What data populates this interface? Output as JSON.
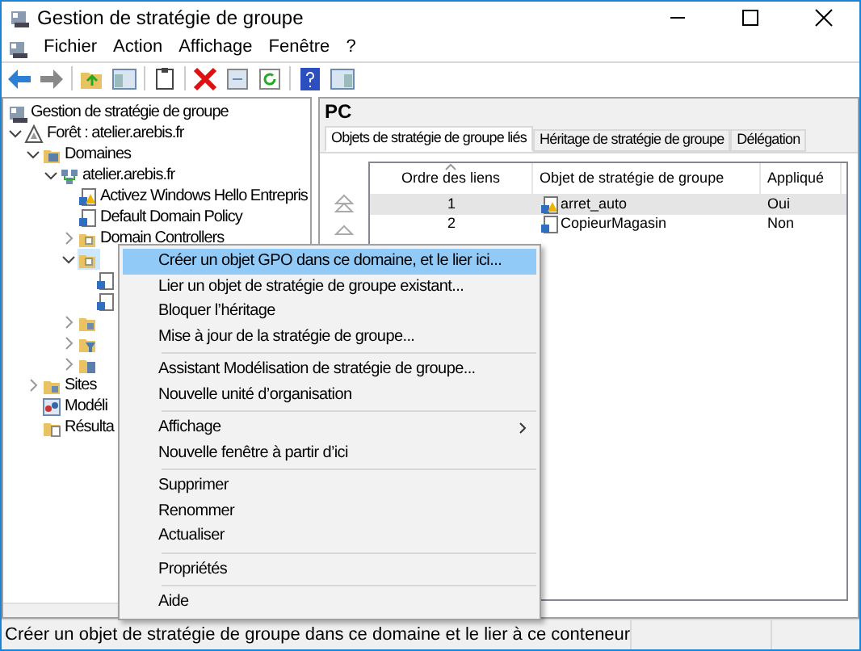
{
  "window": {
    "title": "Gestion de stratégie de groupe"
  },
  "menu_bar": [
    "Fichier",
    "Action",
    "Affichage",
    "Fenêtre",
    "?"
  ],
  "tree": [
    {
      "label": "Gestion de stratégie de groupe",
      "kind": "console",
      "children": [
        {
          "label": "Forêt : atelier.arebis.fr",
          "kind": "forest",
          "expanded": true,
          "children": [
            {
              "label": "Domaines",
              "kind": "domains",
              "expanded": true,
              "children": [
                {
                  "label": "atelier.arebis.fr",
                  "kind": "domain",
                  "expanded": true,
                  "children": [
                    {
                      "label": "Activez Windows Hello Entrepris",
                      "kind": "gpo-warn"
                    },
                    {
                      "label": "Default Domain Policy",
                      "kind": "gpo"
                    },
                    {
                      "label": "Domain Controllers",
                      "kind": "ou",
                      "expanded": false
                    },
                    {
                      "kind": "ou",
                      "expanded": true,
                      "selected": true,
                      "children": [
                        {
                          "kind": "gpo"
                        },
                        {
                          "kind": "gpo"
                        }
                      ]
                    },
                    {
                      "kind": "folder",
                      "expanded": false
                    },
                    {
                      "kind": "filter",
                      "expanded": false
                    },
                    {
                      "kind": "starter",
                      "expanded": false
                    }
                  ]
                }
              ]
            },
            {
              "label": "Sites",
              "kind": "folder",
              "expanded": false
            },
            {
              "label": "Modéli",
              "kind": "modeling"
            },
            {
              "label": "Résulta",
              "kind": "results"
            }
          ]
        }
      ]
    }
  ],
  "details": {
    "heading": "PC",
    "tabs": [
      {
        "label": "Objets de stratégie de groupe liés",
        "selected": true
      },
      {
        "label": "Héritage de stratégie de groupe",
        "selected": false
      },
      {
        "label": "Délégation",
        "selected": false
      }
    ],
    "columns": [
      "Ordre des liens",
      "Objet de stratégie de groupe",
      "Appliqué"
    ],
    "rows": [
      {
        "order": "1",
        "gpo": "arret_auto",
        "kind": "gpo-warn",
        "applied": "Oui",
        "selected": true
      },
      {
        "order": "2",
        "gpo": "CopieurMagasin",
        "kind": "gpo",
        "applied": "Non",
        "selected": false
      }
    ]
  },
  "context_menu": [
    {
      "kind": "item",
      "label": "Créer un objet GPO dans ce domaine, et le lier ici...",
      "selected": true
    },
    {
      "kind": "item",
      "label": "Lier un objet de stratégie de groupe existant...",
      "selected": false
    },
    {
      "kind": "item",
      "label": "Bloquer l’héritage",
      "selected": false
    },
    {
      "kind": "item",
      "label": "Mise à jour de la stratégie de groupe...",
      "selected": false
    },
    {
      "kind": "separator"
    },
    {
      "kind": "item",
      "label": "Assistant Modélisation de stratégie de groupe...",
      "selected": false
    },
    {
      "kind": "item",
      "label": "Nouvelle unité d’organisation",
      "selected": false
    },
    {
      "kind": "separator"
    },
    {
      "kind": "item",
      "label": "Affichage",
      "selected": false,
      "submenu": true
    },
    {
      "kind": "item",
      "label": "Nouvelle fenêtre à partir d’ici",
      "selected": false
    },
    {
      "kind": "separator"
    },
    {
      "kind": "item",
      "label": "Supprimer",
      "selected": false
    },
    {
      "kind": "item",
      "label": "Renommer",
      "selected": false
    },
    {
      "kind": "item",
      "label": "Actualiser",
      "selected": false
    },
    {
      "kind": "separator"
    },
    {
      "kind": "item",
      "label": "Propriétés",
      "selected": false
    },
    {
      "kind": "separator"
    },
    {
      "kind": "item",
      "label": "Aide",
      "selected": false
    }
  ],
  "status_bar": "Créer un objet de stratégie de groupe dans ce domaine et le lier à ce conteneur"
}
